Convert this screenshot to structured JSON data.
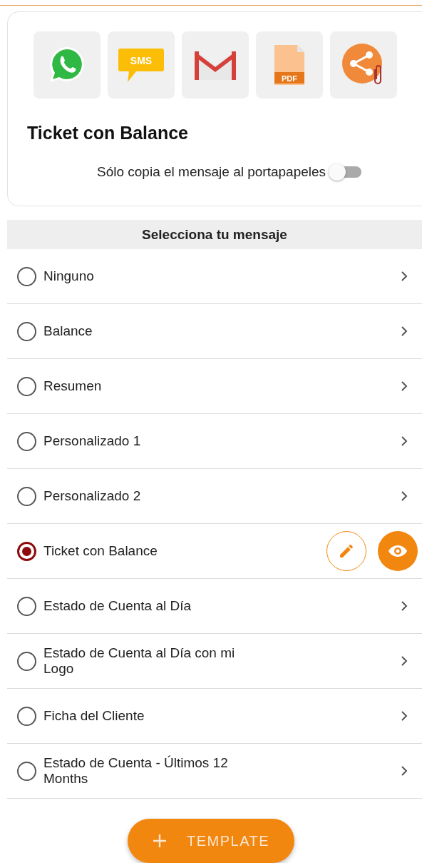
{
  "share_options": [
    {
      "kind": "whatsapp"
    },
    {
      "kind": "sms",
      "label": "SMS"
    },
    {
      "kind": "email"
    },
    {
      "kind": "pdf",
      "label": "PDF"
    },
    {
      "kind": "share"
    }
  ],
  "title": "Ticket con Balance",
  "copy_toggle": {
    "label": "Sólo copia el mensaje al portapapeles",
    "on": false
  },
  "section_header": "Selecciona tu mensaje",
  "messages": [
    {
      "label": "Ninguno",
      "selected": false
    },
    {
      "label": "Balance",
      "selected": false
    },
    {
      "label": "Resumen",
      "selected": false
    },
    {
      "label": "Personalizado 1",
      "selected": false
    },
    {
      "label": "Personalizado 2",
      "selected": false
    },
    {
      "label": "Ticket con Balance",
      "selected": true
    },
    {
      "label": "Estado de Cuenta al Día",
      "selected": false
    },
    {
      "label": "Estado de Cuenta al Día con mi Logo",
      "selected": false
    },
    {
      "label": "Ficha del Cliente",
      "selected": false
    },
    {
      "label": "Estado de Cuenta - Últimos 12 Months",
      "selected": false
    }
  ],
  "add_button": {
    "label": "TEMPLATE"
  }
}
